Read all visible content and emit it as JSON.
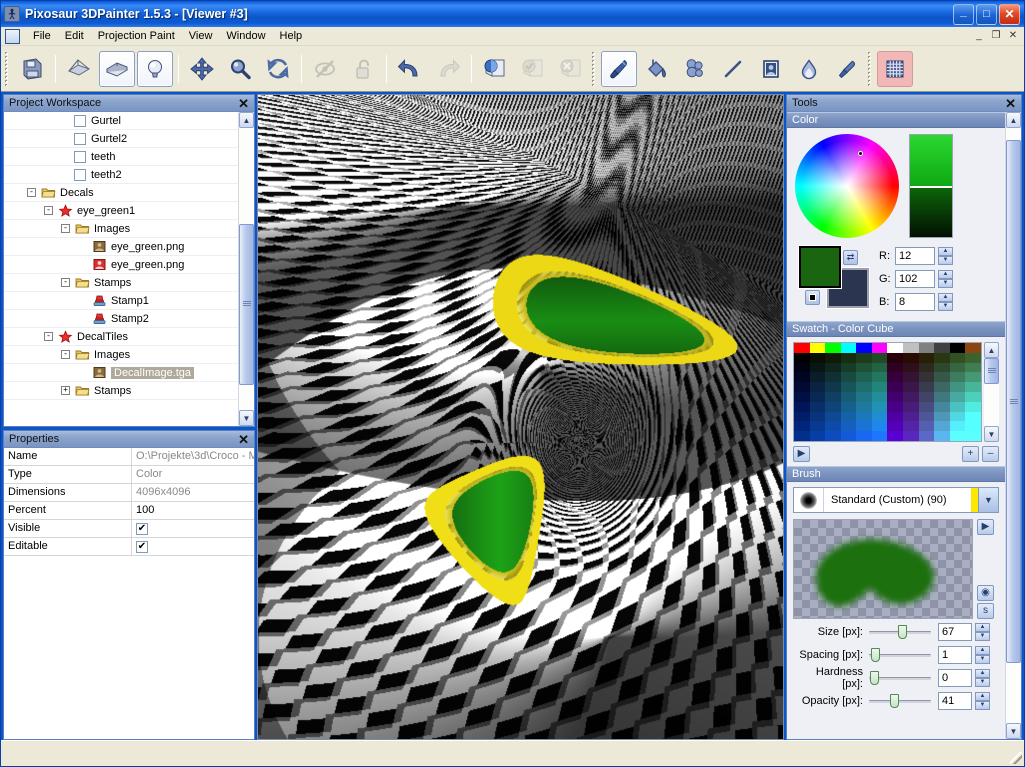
{
  "window": {
    "title": "Pixosaur 3DPainter 1.5.3 - [Viewer #3]",
    "app_icon": "pixosaur-icon",
    "minimize_label": "_",
    "maximize_label": "□",
    "close_label": "✕"
  },
  "menu": {
    "doc_icon": "document-icon",
    "items": [
      "File",
      "Edit",
      "Projection Paint",
      "View",
      "Window",
      "Help"
    ],
    "mdi_buttons": [
      {
        "name": "mdi-minimize",
        "label": "_"
      },
      {
        "name": "mdi-restore",
        "label": "❐"
      },
      {
        "name": "mdi-close",
        "label": "✕"
      }
    ]
  },
  "toolbar": {
    "groups": [
      {
        "buttons": [
          {
            "name": "save-project-button",
            "icon": "floppy-disk-icon",
            "selected": false,
            "disabled": false
          }
        ]
      },
      {
        "buttons": [
          {
            "name": "wireframe-view-button",
            "icon": "mesh-open-icon",
            "selected": false,
            "disabled": false
          },
          {
            "name": "shaded-view-button",
            "icon": "mesh-solid-icon",
            "selected": true,
            "disabled": false
          },
          {
            "name": "light-setup-button",
            "icon": "light-bulb-icon",
            "selected": true,
            "disabled": false
          }
        ]
      },
      {
        "buttons": [
          {
            "name": "pan-tool-button",
            "icon": "move-arrows-icon",
            "selected": false,
            "disabled": false
          },
          {
            "name": "zoom-tool-button",
            "icon": "magnifier-icon",
            "selected": false,
            "disabled": false
          },
          {
            "name": "rotate-tool-button",
            "icon": "rotate-arrows-icon",
            "selected": false,
            "disabled": false
          }
        ]
      },
      {
        "buttons": [
          {
            "name": "hide-visibility-button",
            "icon": "eye-off-icon",
            "selected": false,
            "disabled": true
          },
          {
            "name": "lock-button",
            "icon": "padlock-open-icon",
            "selected": false,
            "disabled": true
          }
        ]
      },
      {
        "buttons": [
          {
            "name": "undo-button",
            "icon": "undo-arrow-icon",
            "selected": false,
            "disabled": false
          },
          {
            "name": "redo-button",
            "icon": "redo-arrow-icon",
            "selected": false,
            "disabled": true
          }
        ]
      },
      {
        "buttons": [
          {
            "name": "new-layer-button",
            "icon": "layer-new-icon",
            "selected": false,
            "disabled": false
          },
          {
            "name": "merge-layer-button",
            "icon": "layer-merge-icon",
            "selected": false,
            "disabled": true
          },
          {
            "name": "delete-layer-button",
            "icon": "layer-delete-icon",
            "selected": false,
            "disabled": true
          }
        ]
      },
      {
        "buttons": [
          {
            "name": "paint-brush-tool-button",
            "icon": "paint-brush-icon",
            "selected": true,
            "disabled": false
          },
          {
            "name": "fill-bucket-tool-button",
            "icon": "paint-bucket-icon",
            "selected": false,
            "disabled": false
          },
          {
            "name": "clone-tool-button",
            "icon": "clone-stamp-icon",
            "selected": false,
            "disabled": false
          },
          {
            "name": "line-tool-button",
            "icon": "line-icon",
            "selected": false,
            "disabled": false
          },
          {
            "name": "decal-stamp-tool-button",
            "icon": "decal-image-icon",
            "selected": false,
            "disabled": false
          },
          {
            "name": "blur-tool-button",
            "icon": "water-drop-icon",
            "selected": false,
            "disabled": false
          },
          {
            "name": "color-picker-tool-button",
            "icon": "eyedropper-icon",
            "selected": false,
            "disabled": false
          }
        ]
      },
      {
        "buttons": [
          {
            "name": "uv-grid-toggle-button",
            "icon": "grid-icon",
            "selected": false,
            "disabled": false,
            "accent": "#f2b8b8"
          }
        ]
      }
    ]
  },
  "project_workspace": {
    "title": "Project Workspace",
    "close_icon": "close-icon",
    "nodes": [
      {
        "depth": 3,
        "toggle": "",
        "icon": "checkbox-unchecked",
        "label": "Gurtel",
        "selected": false
      },
      {
        "depth": 3,
        "toggle": "",
        "icon": "checkbox-unchecked",
        "label": "Gurtel2",
        "selected": false
      },
      {
        "depth": 3,
        "toggle": "",
        "icon": "checkbox-unchecked",
        "label": "teeth",
        "selected": false
      },
      {
        "depth": 3,
        "toggle": "",
        "icon": "checkbox-unchecked",
        "label": "teeth2",
        "selected": false
      },
      {
        "depth": 1,
        "toggle": "-",
        "icon": "folder-icon",
        "label": "Decals",
        "selected": false
      },
      {
        "depth": 2,
        "toggle": "-",
        "icon": "star-red-icon",
        "label": "eye_green1",
        "selected": false
      },
      {
        "depth": 3,
        "toggle": "-",
        "icon": "folder-icon",
        "label": "Images",
        "selected": false
      },
      {
        "depth": 4,
        "toggle": "",
        "icon": "image-brown-icon",
        "label": "eye_green.png",
        "selected": false
      },
      {
        "depth": 4,
        "toggle": "",
        "icon": "image-red-icon",
        "label": "eye_green.png",
        "selected": false
      },
      {
        "depth": 3,
        "toggle": "-",
        "icon": "folder-icon",
        "label": "Stamps",
        "selected": false
      },
      {
        "depth": 4,
        "toggle": "",
        "icon": "stamp-icon",
        "label": "Stamp1",
        "selected": false
      },
      {
        "depth": 4,
        "toggle": "",
        "icon": "stamp-icon",
        "label": "Stamp2",
        "selected": false
      },
      {
        "depth": 2,
        "toggle": "-",
        "icon": "star-red-icon",
        "label": "DecalTiles",
        "selected": false
      },
      {
        "depth": 3,
        "toggle": "-",
        "icon": "folder-icon",
        "label": "Images",
        "selected": false
      },
      {
        "depth": 4,
        "toggle": "",
        "icon": "image-brown-icon",
        "label": "DecalImage.tga",
        "selected": true
      },
      {
        "depth": 3,
        "toggle": "+",
        "icon": "folder-icon",
        "label": "Stamps",
        "selected": false
      }
    ],
    "scroll": {
      "up_icon": "chevron-up-icon",
      "down_icon": "chevron-down-icon",
      "thumb_top_pct": 34,
      "thumb_height_pct": 57
    }
  },
  "properties": {
    "title": "Properties",
    "close_icon": "close-icon",
    "rows": [
      {
        "key": "Name",
        "value": "O:\\Projekte\\3d\\Croco - M",
        "type": "text",
        "gray": true
      },
      {
        "key": "Type",
        "value": "Color",
        "type": "text",
        "gray": true
      },
      {
        "key": "Dimensions",
        "value": "4096x4096",
        "type": "text",
        "gray": true
      },
      {
        "key": "Percent",
        "value": "100",
        "type": "text",
        "gray": false
      },
      {
        "key": "Visible",
        "value": "✔",
        "type": "checkbox",
        "gray": false
      },
      {
        "key": "Editable",
        "value": "✔",
        "type": "checkbox",
        "gray": false
      }
    ]
  },
  "viewport": {
    "name": "viewer-3-canvas",
    "description": "3D crocodile head shaded with black and white checker texture and two green eye decals"
  },
  "tools": {
    "title": "Tools",
    "close_icon": "close-icon",
    "scroll": {
      "up_icon": "chevron-up-icon",
      "down_icon": "chevron-down-icon",
      "thumb_top_pct": 2,
      "thumb_height_pct": 88
    },
    "color": {
      "section_title": "Color",
      "wheel_icon": "color-wheel",
      "cursor_hue_marker": "color-wheel-cursor",
      "value_bar_icon": "value-gradient-bar",
      "foreground_color": "#1a6610",
      "background_color": "#2c3550",
      "swap_icon": "swap-colors-icon",
      "default_icon": "default-colors-icon",
      "r_label": "R:",
      "g_label": "G:",
      "b_label": "B:",
      "r_value": "12",
      "g_value": "102",
      "b_value": "8",
      "spin_up": "▲",
      "spin_down": "▼"
    },
    "swatch": {
      "section_title": "Swatch - Color Cube",
      "top_row": [
        "#ff0000",
        "#ffff00",
        "#00ff00",
        "#00ffff",
        "#0000ff",
        "#ff00ff",
        "#ffffff",
        "#c0c0c0",
        "#808080",
        "#404040",
        "#000000",
        "#8b4513"
      ],
      "play_icon": "play-icon",
      "add_icon": "add-swatch-icon",
      "remove_icon": "remove-swatch-icon",
      "add_label": "+",
      "remove_label": "–",
      "scroll": {
        "up_icon": "chevron-up-icon",
        "down_icon": "chevron-down-icon"
      }
    },
    "brush": {
      "section_title": "Brush",
      "preset_name": "Standard (Custom) (90)",
      "preset_thumb_icon": "soft-round-brush-icon",
      "dropdown_icon": "chevron-down-icon",
      "preview_icon": "brush-shape-preview",
      "preview_color": "#1f7010",
      "play_icon": "play-icon",
      "options_icon": "brush-options-icon",
      "save_icon": "brush-save-icon",
      "sliders": [
        {
          "name": "size",
          "label": "Size [px]:",
          "value": "67",
          "percent": 55
        },
        {
          "name": "spacing",
          "label": "Spacing [px]:",
          "value": "1",
          "percent": 3
        },
        {
          "name": "hardness",
          "label": "Hardness [px]:",
          "value": "0",
          "percent": 2
        },
        {
          "name": "opacity",
          "label": "Opacity [px]:",
          "value": "41",
          "percent": 40
        }
      ],
      "spin_up": "▲",
      "spin_down": "▼"
    }
  },
  "status_bar": {
    "text": ""
  }
}
